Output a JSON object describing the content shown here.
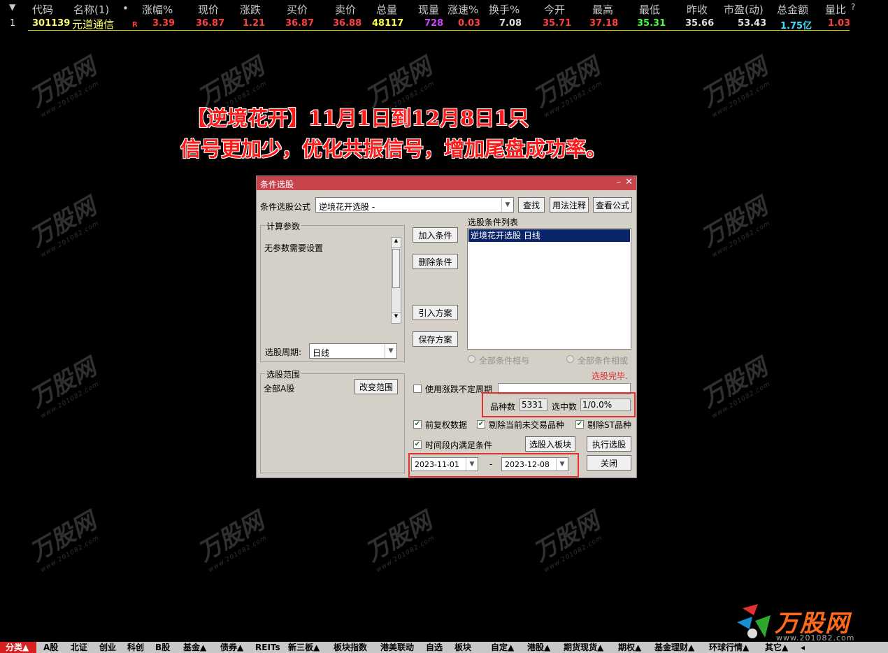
{
  "header": {
    "columns": [
      "代码",
      "名称(1)",
      "•",
      "涨幅%",
      "现价",
      "涨跌",
      "买价",
      "卖价",
      "总量",
      "现量",
      "涨速%",
      "换手%",
      "今开",
      "最高",
      "最低",
      "昨收",
      "市盈(动)",
      "总金额",
      "量比",
      "?"
    ]
  },
  "row": {
    "index": "1",
    "code": "301139",
    "name": "元道通信",
    "flag": "R",
    "change_pct": "3.39",
    "price": "36.87",
    "change": "1.21",
    "bid": "36.87",
    "ask": "36.88",
    "volume": "48117",
    "cur_volume": "728",
    "speed": "0.03",
    "turnover": "7.08",
    "open": "35.71",
    "high": "37.18",
    "low": "35.31",
    "prev_close": "35.66",
    "pe": "53.43",
    "amount": "1.75亿",
    "vol_ratio": "1.03"
  },
  "banner": {
    "line1": "【逆境花开】11月1日到12月8日1只",
    "line2": "信号更加少，优化共振信号，增加尾盘成功率。"
  },
  "dialog": {
    "title": "条件选股",
    "formula_label": "条件选股公式",
    "formula_value": "逆境花开选股  -",
    "find_btn": "查找",
    "usage_btn": "用法注释",
    "view_btn": "查看公式",
    "params_group": "计算参数",
    "params_text": "无参数需要设置",
    "add_btn": "加入条件",
    "del_btn": "删除条件",
    "import_btn": "引入方案",
    "save_btn": "保存方案",
    "list_label": "选股条件列表",
    "list_items": [
      "逆境花开选股  日线"
    ],
    "radio_and": "全部条件相与",
    "radio_or": "全部条件相或",
    "period_label": "选股周期:",
    "period_value": "日线",
    "status": "选股完毕.",
    "range_group": "选股范围",
    "range_value": "全部A股",
    "change_range_btn": "改变范围",
    "use_period_label": "使用涨跌不定周期",
    "count_label": "品种数",
    "count_value": "5331",
    "selected_label": "选中数",
    "selected_value": "1/0.0%",
    "opt_prefix": "前复权数据",
    "opt_exclude_halt": "剔除当前未交易品种",
    "opt_exclude_st": "剔除ST品种",
    "opt_time": "时间段内满足条件",
    "to_board_btn": "选股入板块",
    "exec_btn": "执行选股",
    "close_btn": "关闭",
    "date_from": "2023-11-01",
    "date_sep": "-",
    "date_to": "2023-12-08"
  },
  "watermark": {
    "text": "万股网",
    "sub": "www.201082.com"
  },
  "logo": {
    "text": "万股网",
    "url": "www.201082.com"
  },
  "tabs": [
    "分类▲",
    "A股",
    "北证",
    "创业",
    "科创",
    "B股",
    "基金▲",
    "债券▲",
    "REITs",
    "新三板▲",
    "板块指数",
    "港美联动",
    "自选",
    "板块",
    "自定▲",
    "港股▲",
    "期货现货▲",
    "期权▲",
    "基金理财▲",
    "环球行情▲",
    "其它▲"
  ],
  "colors": {
    "up": "#ff4040",
    "down": "#40ff40",
    "banner": "#ff1a1a",
    "dialog_title": "#c9434a",
    "selected": "#0a246a"
  }
}
